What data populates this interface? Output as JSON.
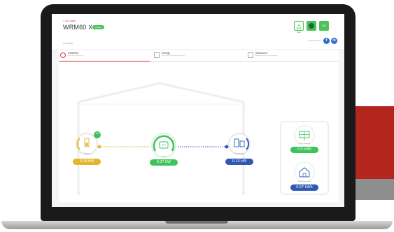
{
  "header": {
    "back_label": "< Go back",
    "device_title": "WRM60 X",
    "status_badge": "Online",
    "subtitle": "0.0 Details",
    "social_label": "Share on social"
  },
  "header_icons": [
    {
      "icon": "plant-icon",
      "caption": "Plant"
    },
    {
      "icon": "device-status-icon",
      "caption": ""
    },
    {
      "icon": "lang-icon",
      "caption": "EN"
    }
  ],
  "social": {
    "facebook": "f",
    "linkedin": "in"
  },
  "tabs": [
    {
      "label": "Realtime",
      "sub": "Real-time performance",
      "icon": "refresh-icon",
      "active": true
    },
    {
      "label": "Energy",
      "sub": "Energy and consumption statistics",
      "icon": "bar-chart-icon",
      "active": false
    },
    {
      "label": "Advanced",
      "sub": "Advanced statistics and analysis",
      "icon": "advanced-chart-icon",
      "active": false
    }
  ],
  "flow": {
    "battery": {
      "value": "0.24 kW",
      "caption": "Storage",
      "soc": "10%"
    },
    "inverter": {
      "value": "0.37 kW",
      "caption": "Inverter"
    },
    "consumption": {
      "value": "0.13 kW",
      "caption": "Consumption"
    },
    "solar": {
      "value": "0.0 kWh",
      "caption": "Solar Production"
    },
    "home": {
      "value": "0.57 kWh",
      "caption": "Home Consumption"
    }
  },
  "colors": {
    "accent_red": "#d9363e",
    "green": "#3cc35a",
    "yellow": "#e2b72a",
    "blue": "#2f58b5"
  }
}
